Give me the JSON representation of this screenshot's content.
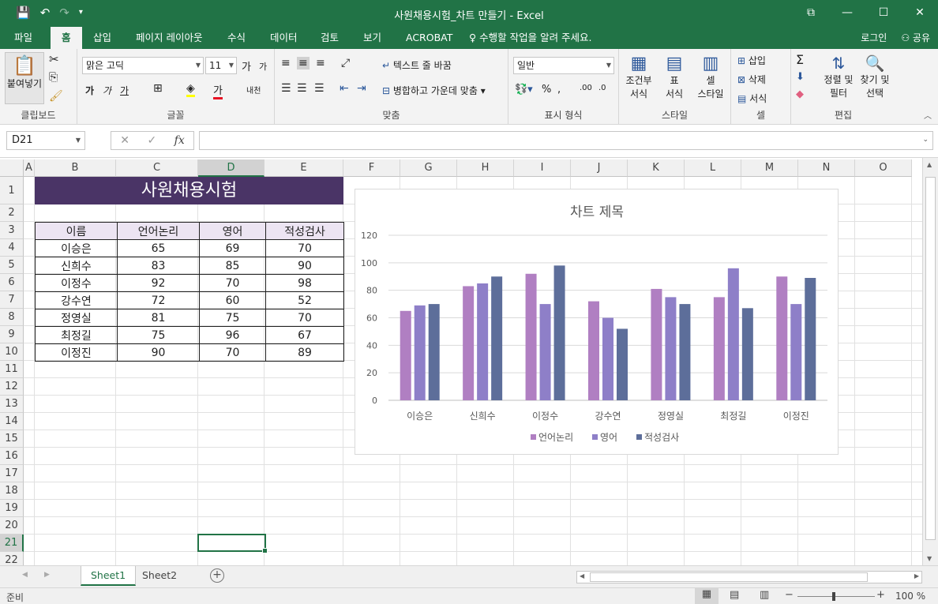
{
  "window": {
    "title": "사원채용시험_차트 만들기 - Excel",
    "buttons": [
      "⧉",
      "—",
      "☐",
      "✕"
    ]
  },
  "quick_access": {
    "save": "💾",
    "undo": "↶",
    "redo": "↷",
    "more": "▾"
  },
  "tabs": [
    "파일",
    "홈",
    "삽입",
    "페이지 레이아웃",
    "수식",
    "데이터",
    "검토",
    "보기",
    "ACROBAT",
    "♀ 수행할 작업을 알려 주세요."
  ],
  "account": {
    "login": "로그인",
    "share": "공유"
  },
  "ribbon": {
    "clipboard": {
      "paste": "붙여넣기",
      "label": "클립보드"
    },
    "font": {
      "name": "맑은 고딕",
      "size": "11",
      "bold": "가",
      "italic": "가",
      "underline": "가",
      "grow": "가",
      "shrink": "가",
      "color_a": "가",
      "phonetic": "내천",
      "label": "글꼴"
    },
    "alignment": {
      "wrap": "텍스트 줄 바꿈",
      "merge": "병합하고 가운데 맞춤",
      "label": "맞춤"
    },
    "number": {
      "format": "일반",
      "percent": "%",
      "label": "표시 형식"
    },
    "styles": {
      "cond": "조건부",
      "cond2": "서식",
      "table": "표",
      "table2": "서식",
      "cell": "셀",
      "cell2": "스타일",
      "label": "스타일"
    },
    "cells": {
      "insert": "삽입",
      "delete": "삭제",
      "format": "서식",
      "label": "셀"
    },
    "editing": {
      "sort": "정렬 및",
      "sort2": "필터",
      "find": "찾기 및",
      "find2": "선택",
      "label": "편집"
    }
  },
  "formula_bar": {
    "namebox": "D21",
    "cancel": "✕",
    "enter": "✓",
    "fx": "fx",
    "value": ""
  },
  "columns": [
    "A",
    "B",
    "C",
    "D",
    "E",
    "F",
    "G",
    "H",
    "I",
    "J",
    "K",
    "L",
    "M",
    "N",
    "O"
  ],
  "rows": [
    "1",
    "2",
    "3",
    "4",
    "5",
    "6",
    "7",
    "8",
    "9",
    "10",
    "11",
    "12",
    "13",
    "14",
    "15",
    "16",
    "17",
    "18",
    "19",
    "20",
    "21",
    "22"
  ],
  "sheet": {
    "title": "사원채용시험",
    "headers": [
      "이름",
      "언어논리",
      "영어",
      "적성검사"
    ],
    "records": [
      [
        "이승은",
        "65",
        "69",
        "70"
      ],
      [
        "신희수",
        "83",
        "85",
        "90"
      ],
      [
        "이정수",
        "92",
        "70",
        "98"
      ],
      [
        "강수연",
        "72",
        "60",
        "52"
      ],
      [
        "정영실",
        "81",
        "75",
        "70"
      ],
      [
        "최정길",
        "75",
        "96",
        "67"
      ],
      [
        "이정진",
        "90",
        "70",
        "89"
      ]
    ]
  },
  "chart_data": {
    "type": "bar",
    "title": "차트 제목",
    "categories": [
      "이승은",
      "신희수",
      "이정수",
      "강수연",
      "정영실",
      "최정길",
      "이정진"
    ],
    "series": [
      {
        "name": "언어논리",
        "values": [
          65,
          83,
          92,
          72,
          81,
          75,
          90
        ],
        "color": "#b07fc2"
      },
      {
        "name": "영어",
        "values": [
          69,
          85,
          70,
          60,
          75,
          96,
          70
        ],
        "color": "#8e7fc8"
      },
      {
        "name": "적성검사",
        "values": [
          70,
          90,
          98,
          52,
          70,
          67,
          89
        ],
        "color": "#5d6e9a"
      }
    ],
    "yticks": [
      "0",
      "20",
      "40",
      "60",
      "80",
      "100",
      "120"
    ],
    "ylim": [
      0,
      120
    ],
    "grid": true,
    "legend": "bottom"
  },
  "sheets": [
    "Sheet1",
    "Sheet2"
  ],
  "status": {
    "mode": "준비",
    "zoom": "100 %"
  }
}
